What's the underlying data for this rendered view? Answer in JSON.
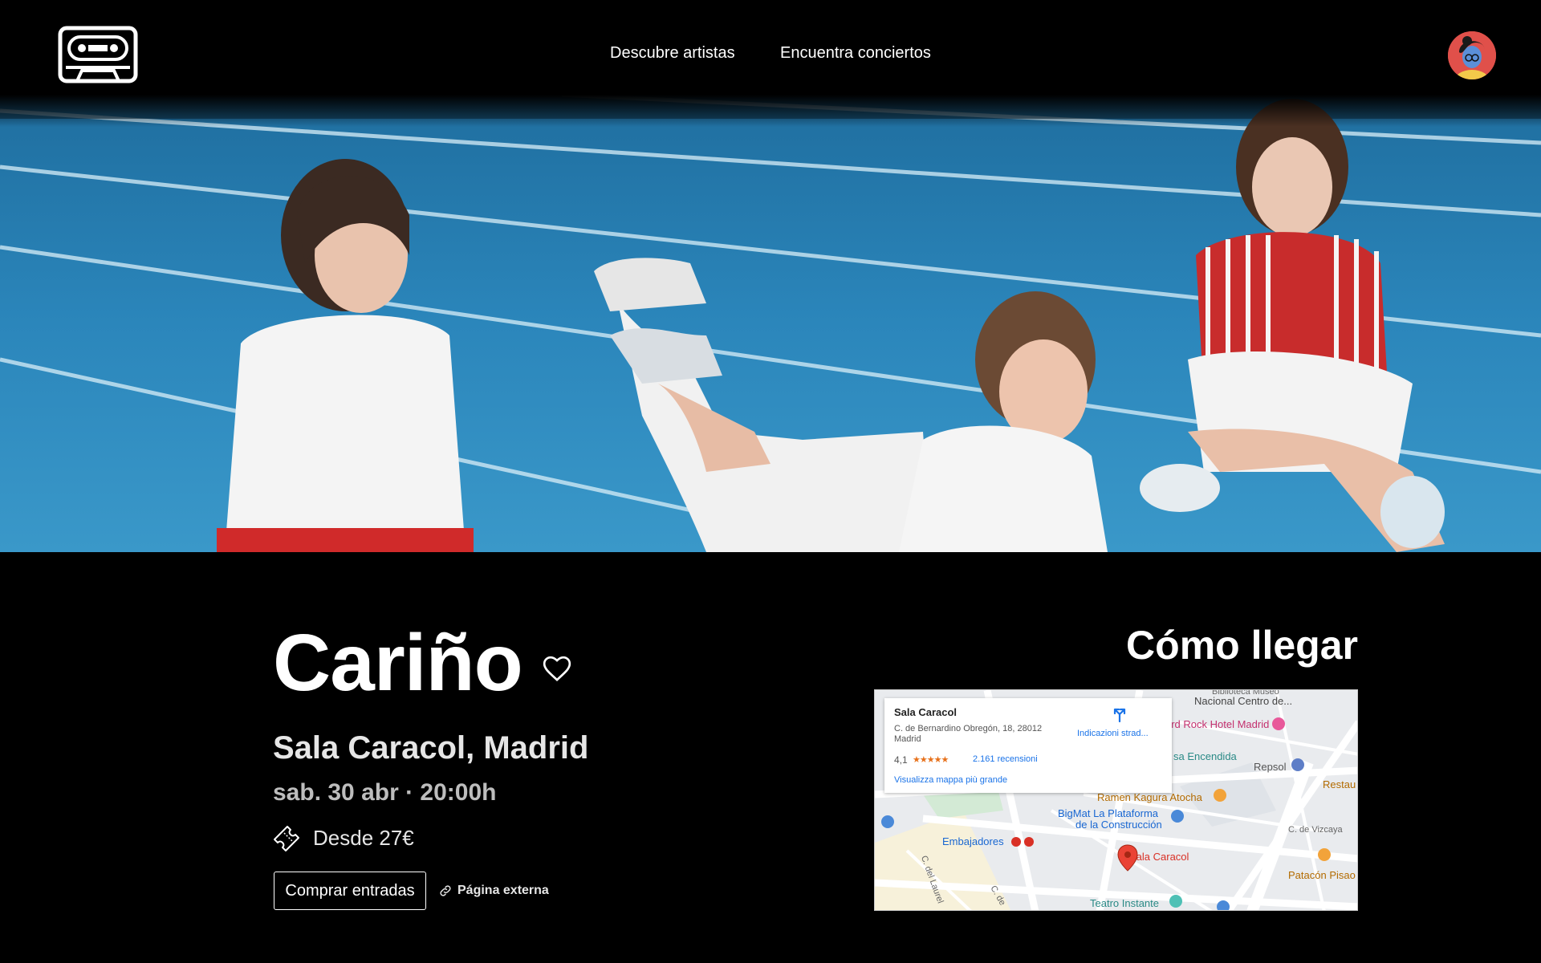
{
  "header": {
    "logo_icon": "cassette-tape-icon",
    "nav": [
      {
        "label": "Descubre artistas"
      },
      {
        "label": "Encuentra conciertos"
      }
    ],
    "avatar_icon": "user-avatar-icon"
  },
  "hero": {
    "image_icon": "band-photo"
  },
  "event": {
    "artist": "Cariño",
    "venue": "Sala Caracol, Madrid",
    "datetime": "sab. 30 abr · 20:00h",
    "price": "Desde 27€",
    "buy_label": "Comprar entradas",
    "external_label": "Página externa"
  },
  "map": {
    "title": "Cómo llegar",
    "card": {
      "name": "Sala Caracol",
      "address": "C. de Bernardino Obregón, 18, 28012 Madrid",
      "rating": "4,1",
      "stars": "★★★★★",
      "reviews": "2.161 recensioni",
      "directions": "Indicazioni strad...",
      "bigger_map": "Visualizza mappa più grande"
    },
    "labels": {
      "biblioteca": "Biblioteca Museo",
      "nacional": "Nacional Centro de...",
      "hardrock": "ard Rock Hotel Madrid",
      "casa": "sa Encendida",
      "repsol": "Repsol",
      "resta": "Restau",
      "ramen": "Ramen Kagura Atocha",
      "bigmat1": "BigMat La Plataforma",
      "bigmat2": "de la Construcción",
      "embajadores": "Embajadores",
      "vizcaya": "C. de Vizcaya",
      "salacaracol": "Sala Caracol",
      "patacon": "Patacón Pisao",
      "teatro": "Teatro Instante",
      "laurel": "C. del Laurel",
      "cde": "C. de"
    }
  },
  "colors": {
    "background": "#000000",
    "map_link": "#1a73e8",
    "pin": "#ea4335"
  }
}
